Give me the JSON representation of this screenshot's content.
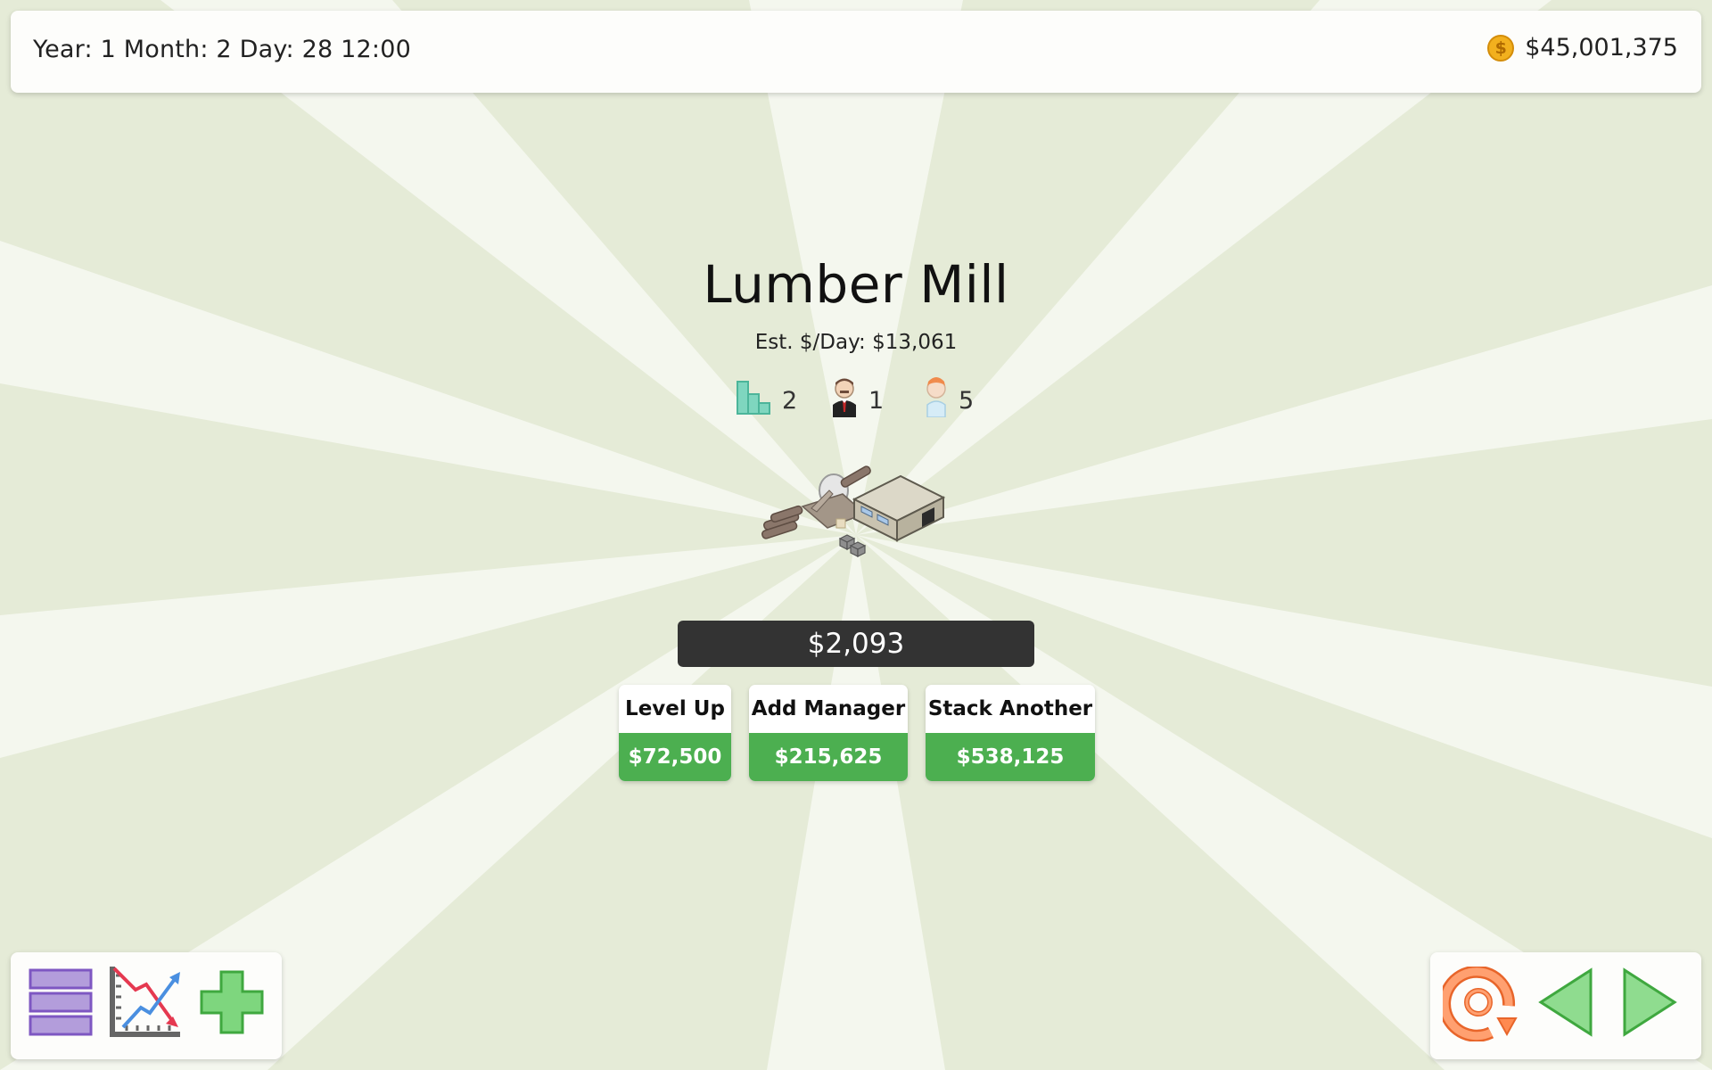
{
  "header": {
    "date_time": "Year: 1 Month: 2 Day: 28 12:00",
    "money": "$45,001,375",
    "coin_symbol": "$",
    "coin_icon": "gold-coin-icon"
  },
  "business": {
    "name": "Lumber Mill",
    "estimate": "Est. $/Day: $13,061",
    "stats": [
      {
        "icon": "level-bars-icon",
        "value": "2"
      },
      {
        "icon": "manager-icon",
        "value": "1"
      },
      {
        "icon": "worker-icon",
        "value": "5"
      }
    ],
    "image_icon": "lumber-mill-building-icon",
    "income": "$2,093"
  },
  "actions": [
    {
      "label": "Level Up",
      "price": "$72,500"
    },
    {
      "label": "Add Manager",
      "price": "$215,625"
    },
    {
      "label": "Stack Another",
      "price": "$538,125"
    }
  ],
  "bottom_left_icons": [
    "menu-icon",
    "stock-chart-icon",
    "add-icon"
  ],
  "bottom_right_icons": [
    "reset-icon",
    "previous-arrow-icon",
    "next-arrow-icon"
  ],
  "colors": {
    "background": "#e5ebd7",
    "ray": "#f3f6ec",
    "accent_green": "#4caf50",
    "income_bar": "#333333",
    "menu_purple": "#b39ddb",
    "plus_green": "#7ed67e",
    "reset_orange": "#ff8a50"
  }
}
